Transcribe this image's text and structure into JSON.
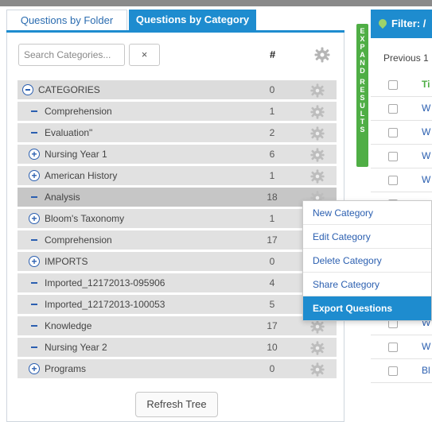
{
  "tabs": [
    {
      "label": "Questions by Folder"
    },
    {
      "label": "Questions by Category"
    }
  ],
  "search": {
    "placeholder": "Search Categories...",
    "clear_label": "×"
  },
  "columns": {
    "count_header": "#"
  },
  "tree": [
    {
      "label": "CATEGORIES",
      "count": "0",
      "toggle": "minus-circle",
      "level": 0
    },
    {
      "label": "Comprehension",
      "count": "1",
      "toggle": "dash",
      "level": 1
    },
    {
      "label": "Evaluation\"",
      "count": "2",
      "toggle": "dash",
      "level": 1
    },
    {
      "label": "Nursing Year 1",
      "count": "6",
      "toggle": "plus",
      "level": 1
    },
    {
      "label": "American History",
      "count": "1",
      "toggle": "plus",
      "level": 1
    },
    {
      "label": "Analysis",
      "count": "18",
      "toggle": "dash",
      "level": 1,
      "selected": true
    },
    {
      "label": "Bloom's Taxonomy",
      "count": "1",
      "toggle": "plus",
      "level": 1
    },
    {
      "label": "Comprehension",
      "count": "17",
      "toggle": "dash",
      "level": 1
    },
    {
      "label": "IMPORTS",
      "count": "0",
      "toggle": "plus",
      "level": 1
    },
    {
      "label": "Imported_12172013-095906",
      "count": "4",
      "toggle": "dash",
      "level": 1
    },
    {
      "label": "Imported_12172013-100053",
      "count": "5",
      "toggle": "dash",
      "level": 1
    },
    {
      "label": "Knowledge",
      "count": "17",
      "toggle": "dash",
      "level": 1
    },
    {
      "label": "Nursing Year 2",
      "count": "10",
      "toggle": "dash",
      "level": 1
    },
    {
      "label": "Programs",
      "count": "0",
      "toggle": "plus",
      "level": 1
    }
  ],
  "refresh_label": "Refresh Tree",
  "expand_strip": {
    "word1": "EXPAND",
    "word2": "RESULTS"
  },
  "filter": {
    "label": "Filter: /"
  },
  "pagination": {
    "previous": "Previous 1"
  },
  "results": {
    "header": "Ti",
    "rows": [
      "W",
      "W",
      "W",
      "W",
      "",
      "",
      "",
      "",
      "W",
      "W",
      "W",
      "Bl"
    ]
  },
  "context_menu": [
    {
      "label": "New Category"
    },
    {
      "label": "Edit Category"
    },
    {
      "label": "Delete Category"
    },
    {
      "label": "Share Category"
    },
    {
      "label": "Export Questions",
      "active": true
    }
  ],
  "colors": {
    "accent": "#1e8ccf",
    "expand": "#4fae45",
    "link": "#2b5fb0"
  }
}
